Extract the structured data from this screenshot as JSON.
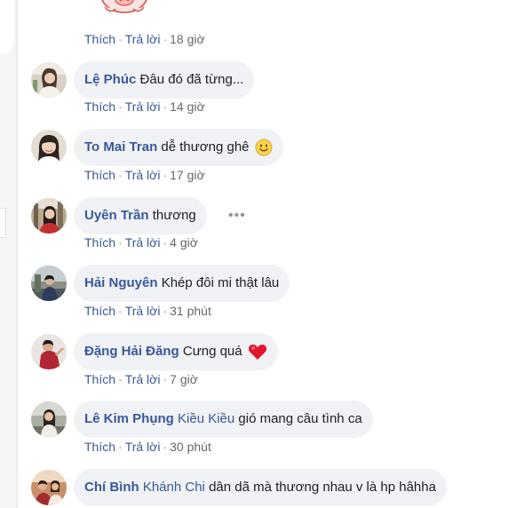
{
  "actions": {
    "like_label": "Thích",
    "reply_label": "Trả lời",
    "separator": "·"
  },
  "comments": [
    {
      "author": "Lệ Phúc",
      "mention": "",
      "text": "Đâu đó đã từng...",
      "emoji": "",
      "time": "14 giờ"
    },
    {
      "author": "To Mai Tran",
      "mention": "",
      "text": "dễ thương ghê",
      "emoji": "smiling-face-icon",
      "time": "17 giờ"
    },
    {
      "author": "Uyên Trần",
      "mention": "",
      "text": "thương",
      "emoji": "",
      "time": "4 giờ"
    },
    {
      "author": "Hải Nguyên",
      "mention": "",
      "text": "Khép đôi mi thật lâu",
      "emoji": "",
      "time": "31 phút"
    },
    {
      "author": "Đặng Hải Đăng",
      "mention": "",
      "text": "Cưng quá",
      "emoji": "red-heart-icon",
      "time": "7 giờ"
    },
    {
      "author": "Lê Kim Phụng",
      "mention": "Kiều Kiều",
      "text": "gió mang câu tình ca",
      "emoji": "",
      "time": "30 phút"
    },
    {
      "author": "Chí Bình",
      "mention": "Khánh Chi",
      "text": "dân dã mà thương nhau v là hp hâhha",
      "emoji": "",
      "time": ""
    }
  ],
  "top_item": {
    "time": "18 giờ",
    "sticker": "pig-sticker"
  },
  "colors": {
    "link": "#385898",
    "bubble": "#f0f2f5",
    "meta": "#65676b"
  }
}
